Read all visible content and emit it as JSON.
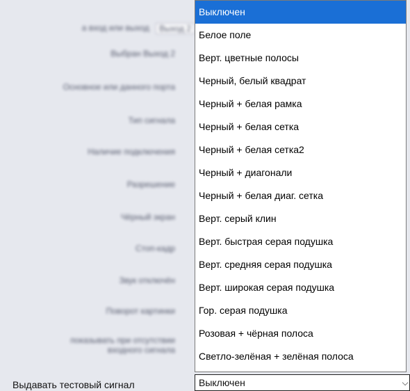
{
  "settings": {
    "blurred_rows": [
      "а вход или выход",
      "Выбран Выход 2",
      "Основное или данного порта",
      "Тип сигнала",
      "Наличие подключения",
      "Разрешение",
      "Чёрный экран",
      "Стоп-кадр",
      "Звук отключён",
      "Поворот картинки",
      "показывать при отсутствии входного сигнала"
    ],
    "blurred_value": "Выход 2",
    "test_signal_label": "Выдавать тестовый сигнал"
  },
  "test_signal_select": {
    "value": "Выключен",
    "options": [
      "Выключен",
      "Белое поле",
      "Верт. цветные полосы",
      "Черный, белый квадрат",
      "Черный + белая рамка",
      "Черный + белая сетка",
      "Черный + белая сетка2",
      "Черный + диагонали",
      "Черный + белая диаг. сетка",
      "Верт. серый клин",
      "Верт. быстрая серая подушка",
      "Верт. средняя серая подушка",
      "Верт. широкая серая подушка",
      "Гор. серая подушка",
      "Розовая + чёрная полоса",
      "Светло-зелёная + зелёная полоса"
    ],
    "selected_index": 0
  }
}
